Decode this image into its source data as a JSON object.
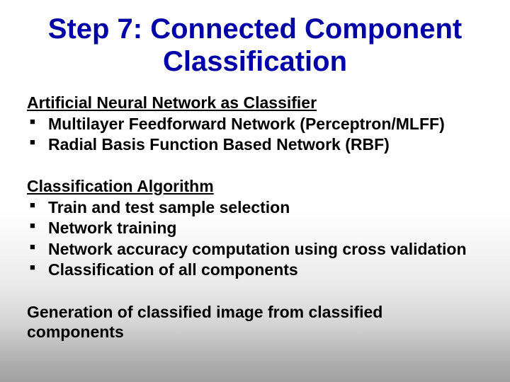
{
  "title": "Step 7: Connected Component Classification",
  "section1": {
    "heading": "Artificial Neural Network as Classifier",
    "items": [
      "Multilayer Feedforward Network (Perceptron/MLFF)",
      "Radial Basis Function Based Network (RBF)"
    ]
  },
  "section2": {
    "heading": "Classification Algorithm",
    "items": [
      "Train and test sample selection",
      "Network training",
      "Network accuracy computation using cross validation",
      "Classification of all components"
    ]
  },
  "footer": "Generation of classified image from classified components"
}
